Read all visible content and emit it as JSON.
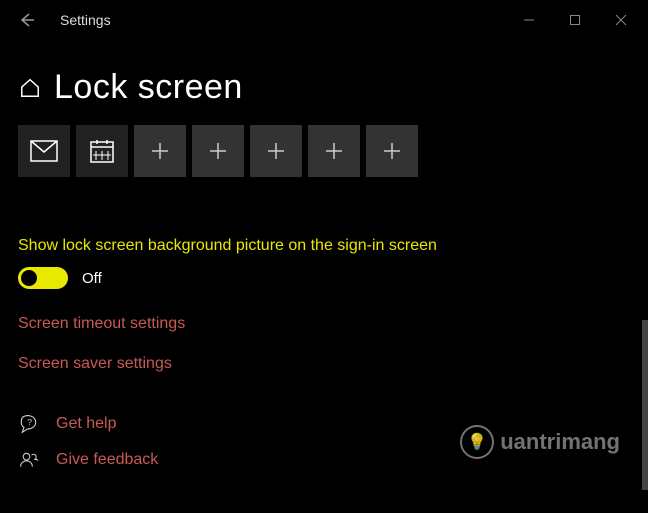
{
  "window": {
    "app_name": "Settings"
  },
  "header": {
    "title": "Lock screen"
  },
  "tiles": [
    {
      "name": "mail-icon",
      "type": "app"
    },
    {
      "name": "calendar-icon",
      "type": "app"
    },
    {
      "name": "plus-icon",
      "type": "add"
    },
    {
      "name": "plus-icon",
      "type": "add"
    },
    {
      "name": "plus-icon",
      "type": "add"
    },
    {
      "name": "plus-icon",
      "type": "add"
    },
    {
      "name": "plus-icon",
      "type": "add"
    }
  ],
  "setting": {
    "label": "Show lock screen background picture on the sign-in screen",
    "toggle_state": "Off"
  },
  "links": {
    "timeout": "Screen timeout settings",
    "saver": "Screen saver settings",
    "help": "Get help",
    "feedback": "Give feedback"
  },
  "watermark": "uantrimang"
}
